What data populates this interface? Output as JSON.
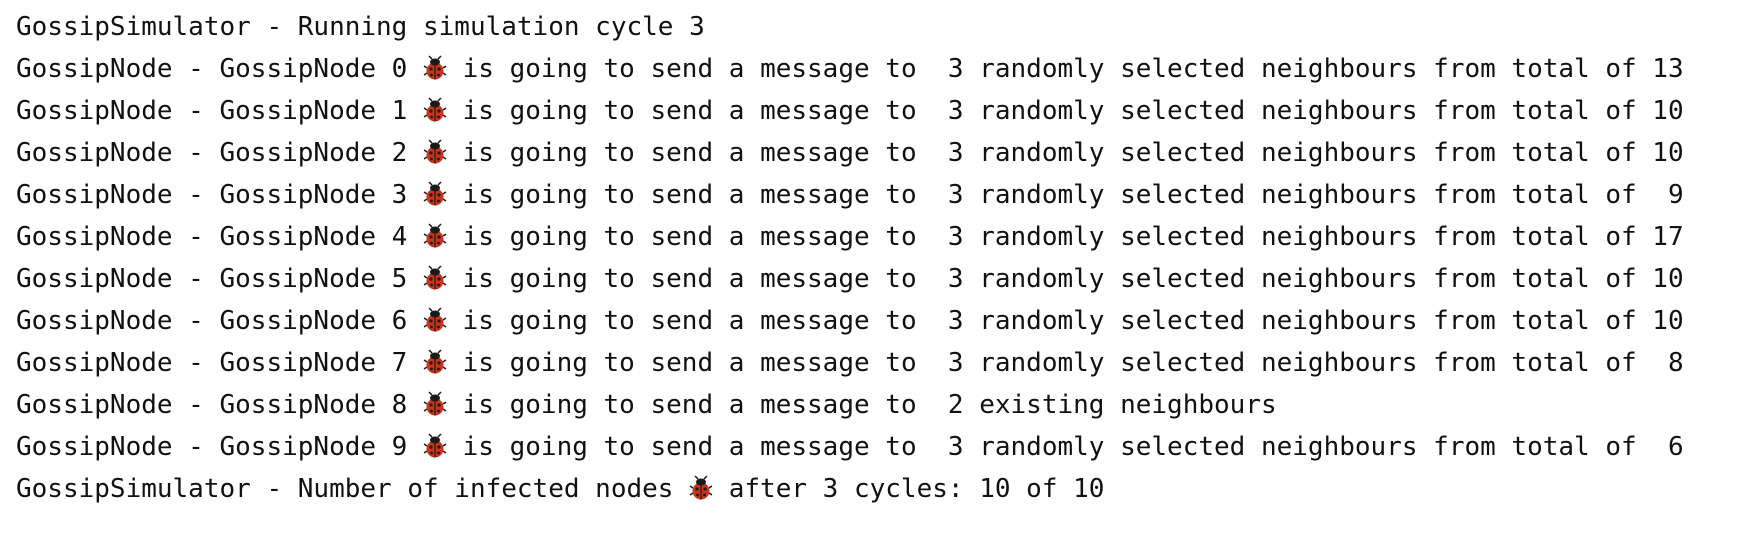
{
  "console": {
    "lines": [
      {
        "kind": "plain",
        "text": "GossipSimulator - Running simulation cycle 3"
      },
      {
        "kind": "node",
        "prefix": "GossipNode - GossipNode 0 ",
        "suffix": " is going to send a message to  3 randomly selected neighbours from total of 13"
      },
      {
        "kind": "node",
        "prefix": "GossipNode - GossipNode 1 ",
        "suffix": " is going to send a message to  3 randomly selected neighbours from total of 10"
      },
      {
        "kind": "node",
        "prefix": "GossipNode - GossipNode 2 ",
        "suffix": " is going to send a message to  3 randomly selected neighbours from total of 10"
      },
      {
        "kind": "node",
        "prefix": "GossipNode - GossipNode 3 ",
        "suffix": " is going to send a message to  3 randomly selected neighbours from total of  9"
      },
      {
        "kind": "node",
        "prefix": "GossipNode - GossipNode 4 ",
        "suffix": " is going to send a message to  3 randomly selected neighbours from total of 17"
      },
      {
        "kind": "node",
        "prefix": "GossipNode - GossipNode 5 ",
        "suffix": " is going to send a message to  3 randomly selected neighbours from total of 10"
      },
      {
        "kind": "node",
        "prefix": "GossipNode - GossipNode 6 ",
        "suffix": " is going to send a message to  3 randomly selected neighbours from total of 10"
      },
      {
        "kind": "node",
        "prefix": "GossipNode - GossipNode 7 ",
        "suffix": " is going to send a message to  3 randomly selected neighbours from total of  8"
      },
      {
        "kind": "node",
        "prefix": "GossipNode - GossipNode 8 ",
        "suffix": " is going to send a message to  2 existing neighbours"
      },
      {
        "kind": "node",
        "prefix": "GossipNode - GossipNode 9 ",
        "suffix": " is going to send a message to  3 randomly selected neighbours from total of  6"
      },
      {
        "kind": "node",
        "prefix": "GossipSimulator - Number of infected nodes ",
        "suffix": " after 3 cycles: 10 of 10"
      }
    ],
    "icon": "ladybug-icon",
    "colors": {
      "text": "#111111",
      "background": "#ffffff",
      "bug_body": "#c8341c",
      "bug_head": "#1a1a1a"
    }
  }
}
